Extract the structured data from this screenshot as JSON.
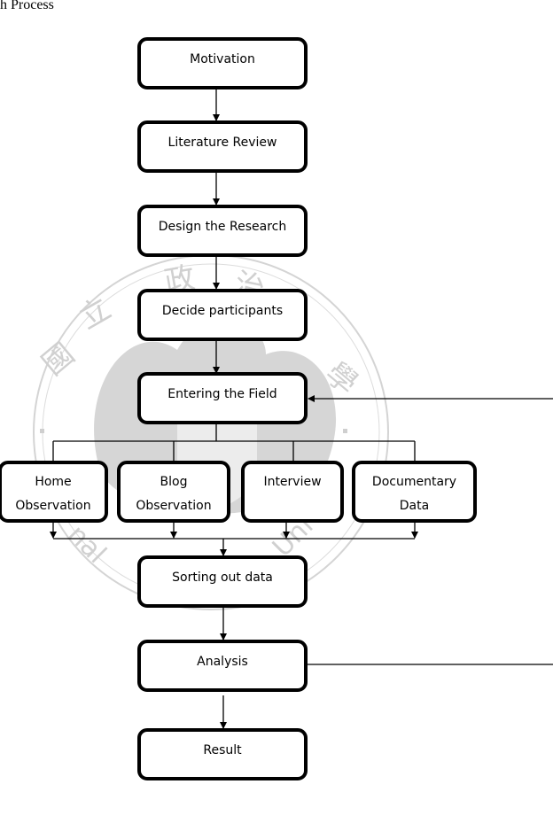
{
  "caption": "h Process",
  "watermark": {
    "description": "university seal watermark",
    "characters": [
      "國",
      "立",
      "政",
      "治",
      "學"
    ],
    "text_fragments": [
      "nal",
      "Univ"
    ],
    "color": "#c8c8c8"
  },
  "nodes": {
    "motivation": "Motivation",
    "literature_review": "Literature Review",
    "design_research": "Design the Research",
    "decide_participants": "Decide participants",
    "entering_field": "Entering the Field",
    "home_observation": "Home\nObservation",
    "blog_observation": "Blog\nObservation",
    "interview": "Interview",
    "documentary_data": "Documentary\nData",
    "sorting_data": "Sorting out data",
    "analysis": "Analysis",
    "result": "Result"
  },
  "colors": {
    "stroke": "#000000",
    "background": "#ffffff"
  }
}
